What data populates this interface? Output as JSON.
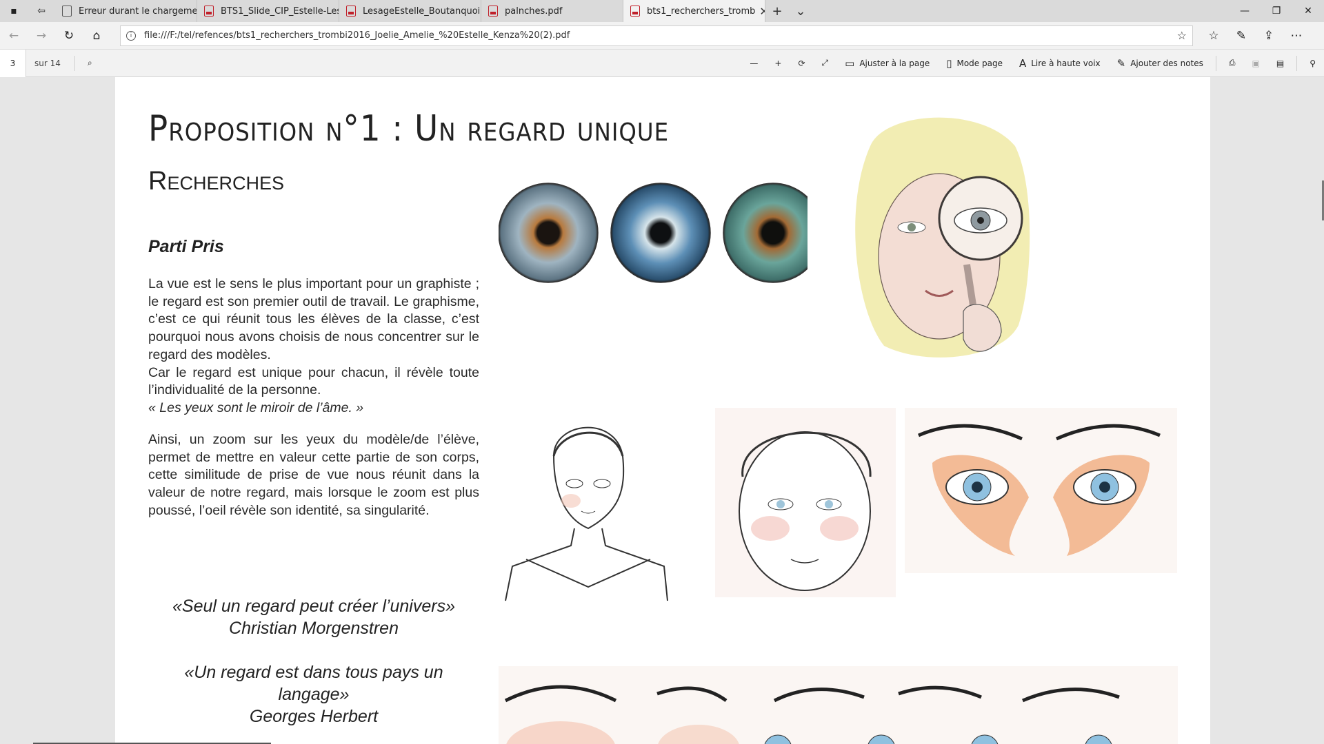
{
  "tabs": [
    {
      "title": "Erreur durant le chargemen",
      "icon": "page-error-icon",
      "active": false
    },
    {
      "title": "BTS1_Slide_CIP_Estelle-Lesa",
      "icon": "pdf-icon",
      "active": false
    },
    {
      "title": "LesageEstelle_BoutanquoiM",
      "icon": "pdf-icon",
      "active": false
    },
    {
      "title": "palnches.pdf",
      "icon": "pdf-icon",
      "active": false
    },
    {
      "title": "bts1_recherchers_tromb",
      "icon": "pdf-icon",
      "active": true
    }
  ],
  "address": {
    "url": "file:///F:/tel/refences/bts1_recherchers_trombi2016_Joelie_Amelie_%20Estelle_Kenza%20(2).pdf"
  },
  "pdf_toolbar": {
    "current_page": "3",
    "page_total": "sur 14",
    "fit_page": "Ajuster à la page",
    "page_mode": "Mode page",
    "read_aloud": "Lire à haute voix",
    "add_notes": "Ajouter des notes"
  },
  "document": {
    "title": "Proposition n°1 : Un regard unique",
    "subtitle": "Recherches",
    "section": "Parti Pris",
    "para1": "La vue est le sens le plus important pour un graphiste ; le regard est son premier outil de travail. Le graphisme, c’est ce qui réunit tous les élèves de la classe, c’est pourquoi nous avons choisis de nous concentrer sur le regard des modèles.",
    "para1b": "Car le regard est unique pour chacun, il révèle toute l’individualité de la personne.",
    "para1_quote": "« Les yeux sont le miroir de l’âme. »",
    "para2": "Ainsi, un zoom sur les yeux du modèle/de l’élève, permet de mettre en valeur cette partie de son corps, cette similitude de prise de vue nous réunit dans la valeur de notre regard, mais lorsque le zoom est plus poussé, l’oeil révèle son identité, sa singularité.",
    "quote1": "«Seul un regard peut créer l’univers»",
    "quote1_author": "Christian Morgenstren",
    "quote2": "«Un regard est dans tous pays un langage»",
    "quote2_author": "Georges Herbert"
  },
  "colors": {
    "tab_bar": "#dadada",
    "chrome": "#f2f2f2",
    "viewer_bg": "#e6e6e6",
    "pdf_icon": "#c0202a"
  }
}
